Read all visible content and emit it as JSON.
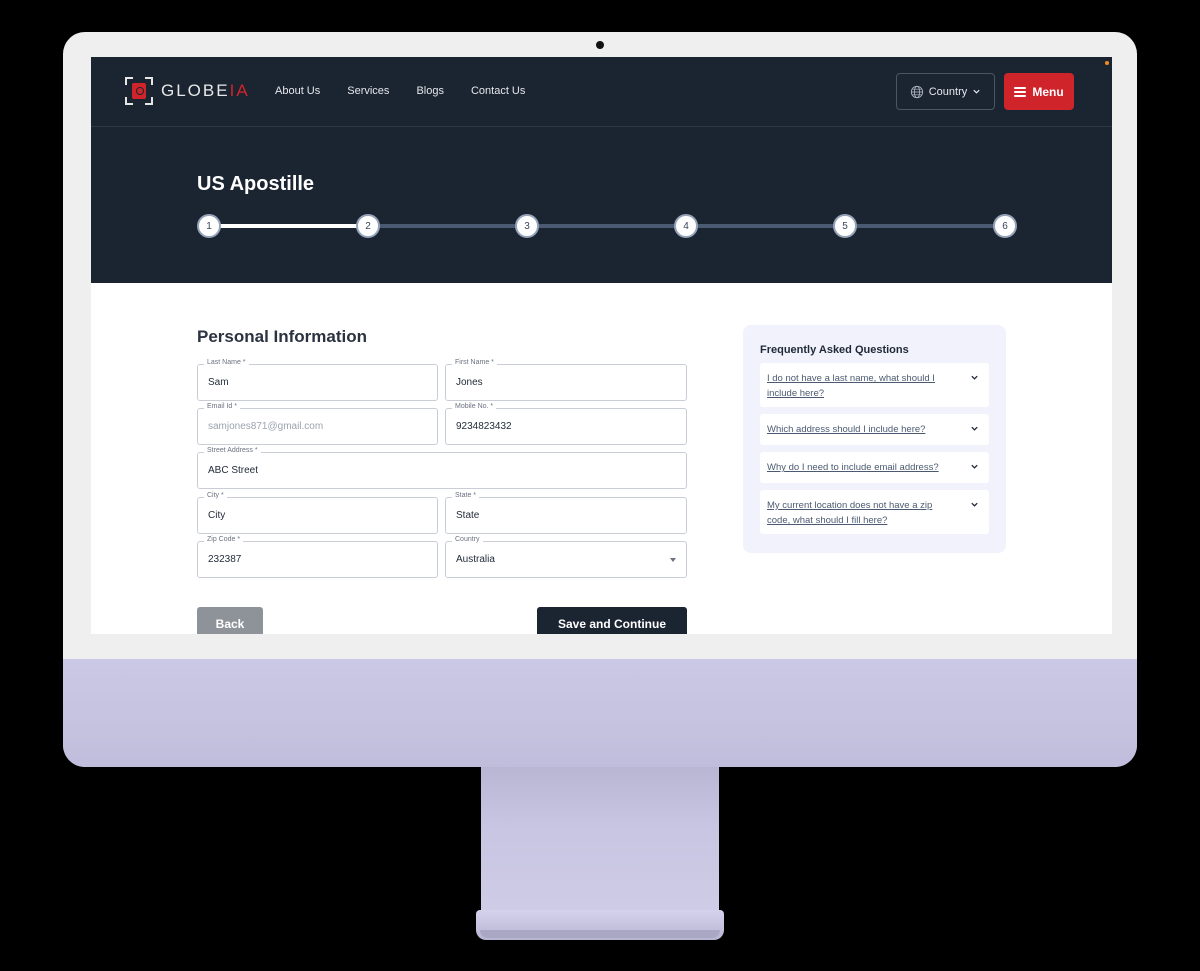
{
  "brand": {
    "name_main": "GLOBE",
    "name_accent": "IA"
  },
  "nav": {
    "links": [
      "About Us",
      "Services",
      "Blogs",
      "Contact Us"
    ],
    "country_label": "Country",
    "menu_label": "Menu"
  },
  "hero": {
    "title": "US Apostille",
    "steps": [
      "1",
      "2",
      "3",
      "4",
      "5",
      "6"
    ],
    "current_step": 2
  },
  "form": {
    "title": "Personal Information",
    "fields": {
      "last_name": {
        "label": "Last Name *",
        "value": "Sam"
      },
      "first_name": {
        "label": "First Name *",
        "value": "Jones"
      },
      "email": {
        "label": "Email Id *",
        "value": "samjones871@gmail.com"
      },
      "mobile": {
        "label": "Mobile No. *",
        "value": "9234823432"
      },
      "street": {
        "label": "Street Address *",
        "value": "ABC Street"
      },
      "city": {
        "label": "City *",
        "value": "City"
      },
      "state": {
        "label": "State *",
        "value": "State"
      },
      "zip": {
        "label": "Zip Code *",
        "value": "232387"
      },
      "country": {
        "label": "Country",
        "value": "Australia"
      }
    },
    "back_label": "Back",
    "save_label": "Save and Continue"
  },
  "faq": {
    "title": "Frequently Asked Questions",
    "items": [
      "I do not have a last name, what should I include here?",
      "Which address should I include here?",
      "Why do I need to include email address?",
      "My current location does not have a zip code, what should I fill here?"
    ]
  },
  "colors": {
    "navy": "#1b2431",
    "accent_red": "#d0242b",
    "faq_bg": "#f1f2fb"
  },
  "icons": {
    "globe": "globe-icon",
    "chevron": "chevron-down-icon",
    "menu": "hamburger-icon"
  }
}
